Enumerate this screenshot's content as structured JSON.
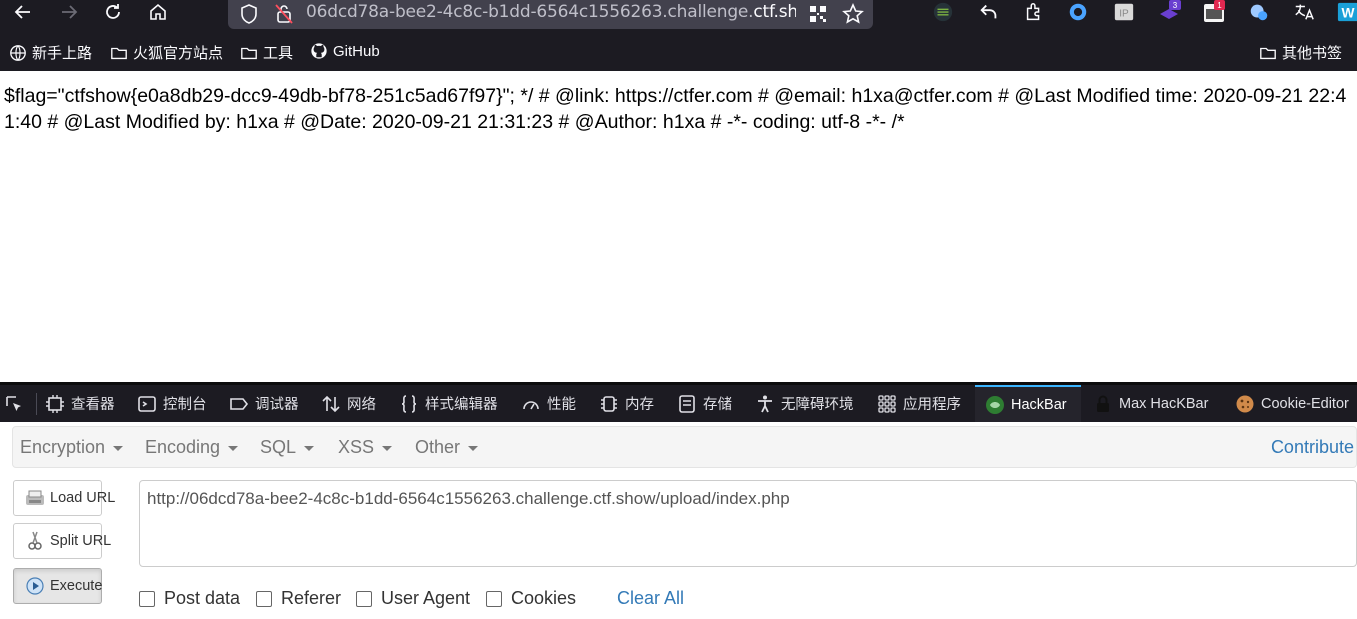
{
  "browser": {
    "url_prefix": "06dcd78a-bee2-4c8c-b1dd-6564c1556263.challenge.",
    "url_domain": "ctf.sho",
    "bookmarks": [
      {
        "label": "新手上路",
        "icon": "globe-icon"
      },
      {
        "label": "火狐官方站点",
        "icon": "folder-icon"
      },
      {
        "label": "工具",
        "icon": "folder-icon"
      },
      {
        "label": "GitHub",
        "icon": "github-icon"
      }
    ],
    "other_bookmarks": "其他书签",
    "extensions": [
      {
        "name": "ext-lines-icon",
        "color": "#2e7d32"
      },
      {
        "name": "ext-undo-icon",
        "color": "#fbfbfe"
      },
      {
        "name": "ext-puzzle-icon",
        "color": "#fbfbfe"
      },
      {
        "name": "ext-circle-icon",
        "color": "#4aa3ff"
      },
      {
        "name": "ext-ip-icon",
        "color": "#d0d0d0",
        "label": "IP"
      },
      {
        "name": "ext-badge-icon",
        "color": "#6a3fd0",
        "label": "3"
      },
      {
        "name": "ext-red-icon",
        "color": "#e22850",
        "label": "1"
      },
      {
        "name": "ext-globe-icon",
        "color": "#4aa3ff"
      },
      {
        "name": "ext-translate-icon",
        "color": "#fbfbfe"
      },
      {
        "name": "ext-w-icon",
        "color": "#1aa0d8",
        "label": "W"
      }
    ]
  },
  "content": {
    "text": "$flag=\"ctfshow{e0a8db29-dcc9-49db-bf78-251c5ad67f97}\"; */ # @link: https://ctfer.com # @email: h1xa@ctfer.com # @Last Modified time: 2020-09-21 22:41:40 # @Last Modified by: h1xa # @Date: 2020-09-21 21:31:23 # @Author: h1xa # -*- coding: utf-8 -*- /*"
  },
  "devtools": {
    "tabs": [
      {
        "label": "查看器",
        "icon": "inspector-icon"
      },
      {
        "label": "控制台",
        "icon": "console-icon"
      },
      {
        "label": "调试器",
        "icon": "debugger-icon"
      },
      {
        "label": "网络",
        "icon": "network-icon"
      },
      {
        "label": "样式编辑器",
        "icon": "style-editor-icon"
      },
      {
        "label": "性能",
        "icon": "performance-icon"
      },
      {
        "label": "内存",
        "icon": "memory-icon"
      },
      {
        "label": "存储",
        "icon": "storage-icon"
      },
      {
        "label": "无障碍环境",
        "icon": "accessibility-icon"
      },
      {
        "label": "应用程序",
        "icon": "application-icon"
      },
      {
        "label": "HackBar",
        "icon": "hackbar-icon"
      },
      {
        "label": "Max HacKBar",
        "icon": "lock-icon"
      },
      {
        "label": "Cookie-Editor",
        "icon": "cookie-icon"
      }
    ]
  },
  "hackbar": {
    "menus": [
      "Encryption",
      "Encoding",
      "SQL",
      "XSS",
      "Other"
    ],
    "contribute": "Contribute",
    "buttons": {
      "load": "Load URL",
      "split": "Split URL",
      "execute": "Execute"
    },
    "url_value": "http://06dcd78a-bee2-4c8c-b1dd-6564c1556263.challenge.ctf.show/upload/index.php",
    "checkboxes": [
      "Post data",
      "Referer",
      "User Agent",
      "Cookies"
    ],
    "clear_all": "Clear All"
  }
}
